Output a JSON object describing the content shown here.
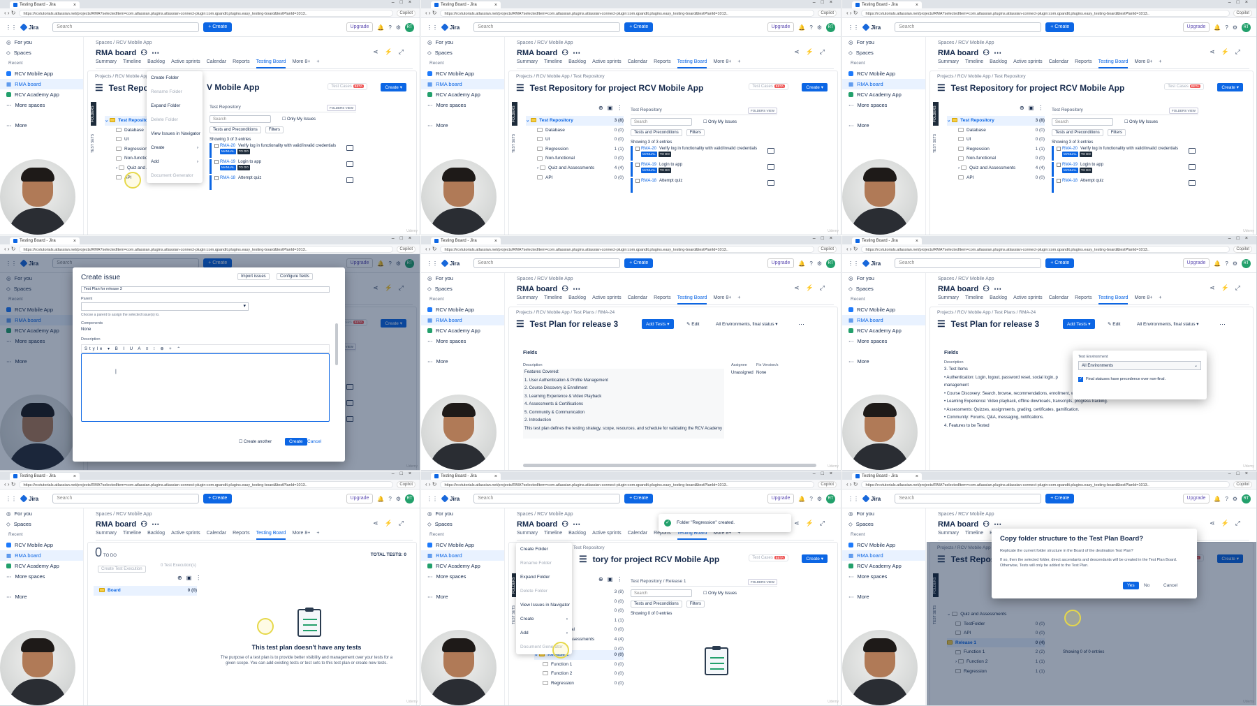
{
  "browser": {
    "tab_title": "Testing Board - Jira",
    "url": "https://rcvtutorials.atlassian.net/projects/RMA?selectedItem=com.atlassian.plugins.atlassian-connect-plugin:com.qpandit.plugins.easy_testing-board&testPlanId=1013..",
    "copilot": "Copilot"
  },
  "topnav": {
    "product": "Jira",
    "search_placeholder": "Search",
    "create": "+ Create",
    "upgrade": "Upgrade",
    "avatar": "RT"
  },
  "sidebar": {
    "for_you": "For you",
    "spaces": "Spaces",
    "recent": "Recent",
    "item1": "RCV Mobile App",
    "item2": "RMA board",
    "item3": "RCV Academy App",
    "more_spaces": "More spaces",
    "more": "More"
  },
  "board": {
    "breadcrumb": "Spaces / RCV Mobile App",
    "title": "RMA board",
    "tabs": [
      "Summary",
      "Timeline",
      "Backlog",
      "Active sprints",
      "Calendar",
      "Reports",
      "Testing Board",
      "More 8+"
    ]
  },
  "repo": {
    "breadcrumb": "Projects / RCV Mobile App / Test Repository",
    "title": "Test Repository for project RCV Mobile App",
    "title_short": "Test Repositor",
    "title_tail": "V Mobile App",
    "title_cut": "tory for project RCV Mobile App",
    "test_cases": "Test Cases",
    "beta": "BETA",
    "create": "Create",
    "folders": "FOLDERS",
    "test_sets": "TEST SETS",
    "tree": [
      {
        "label": "Test Repository",
        "count": "3 (8)"
      },
      {
        "label": "Database",
        "count": "0 (0)"
      },
      {
        "label": "UI",
        "count": "0 (0)"
      },
      {
        "label": "Regression",
        "count": "1 (1)"
      },
      {
        "label": "Non-functional",
        "count": "0 (0)"
      },
      {
        "label": "Quiz and Assessments",
        "count": "4 (4)"
      },
      {
        "label": "API",
        "count": "0 (0)"
      }
    ],
    "right_head": "Test Repository",
    "folders_view": "FOLDERS VIEW",
    "search": "Search",
    "only_my": "Only My Issues",
    "tests_precond": "Tests and Preconditions",
    "filters": "Filters",
    "showing": "Showing 3 of 3 entries",
    "items": [
      {
        "key": "RMA-20",
        "summary": "Verify log in functionality with valid/invalid credentials",
        "type": "MANUAL",
        "status": "TO DO"
      },
      {
        "key": "RMA-19",
        "summary": "Login to app",
        "type": "MANUAL",
        "status": "TO DO"
      },
      {
        "key": "RMA-18",
        "summary": "Attempt quiz",
        "type": "",
        "status": ""
      }
    ]
  },
  "context_menu": [
    "Create Folder",
    "Rename Folder",
    "Expand Folder",
    "Delete Folder",
    "View Issues in Navigator",
    "Create",
    "Add",
    "Document Generator"
  ],
  "create_issue": {
    "title": "Create issue",
    "import": "Import issues",
    "configure": "Configure fields",
    "summary_value": "Test Plan for release 3",
    "parent": "Parent",
    "parent_hint": "Choose a parent to assign the selected issue(s) to.",
    "components": "Components",
    "components_val": "None",
    "description": "Description",
    "style": "Style",
    "create_another": "Create another",
    "create": "Create",
    "cancel": "Cancel"
  },
  "plan": {
    "breadcrumb": "Projects / RCV Mobile App / Test Plans / RMA-24",
    "title": "Test Plan for release 3",
    "add_tests": "Add Tests",
    "edit": "Edit",
    "env": "All Environments, final status",
    "fields": "Fields",
    "description": "Description",
    "assignee": "Assignee",
    "assignee_val": "Unassigned",
    "fix_version": "Fix Version/s",
    "fix_val": "None",
    "features": "Features Covered:",
    "feature_list": [
      "1.  User Authentication & Profile Management",
      "2.  Course Discovery & Enrollment",
      "3.  Learning Experience & Video Playback",
      "4.  Assessments & Certifications",
      "5.  Community & Communication"
    ],
    "intro": "2. Introduction",
    "intro_text": "This test plan defines the testing strategy, scope, resources, and schedule for validating the RCV Academy",
    "test_env_label": "Test Environment",
    "test_env_val": "All Environments",
    "final_status": "Final statuses have precedence over non-final.",
    "desc2": [
      "3. Test Items",
      "•  Authentication: Login, logout, password reset, social login, p",
      "management",
      "•  Course Discovery: Search, browse, recommendations, enrollment, wishlist.",
      "•  Learning Experience: Video playback, offline downloads, transcripts, progress tracking.",
      "•  Assessments: Quizzes, assignments, grading, certificates, gamification.",
      "•  Community: Forums, Q&A, messaging, notifications.",
      "4. Features to be Tested"
    ]
  },
  "planboard": {
    "count": "0",
    "todo": "TO DO",
    "total": "TOTAL TESTS: 0",
    "create_exec": "Create Test Execution",
    "execs": "0 Test Execution(s)",
    "board": "Board",
    "board_count": "0 (0)",
    "empty_title": "This test plan doesn't have any tests",
    "empty_text": "The purpose of a test plan is to provide better visibility and management over your tests for a given scope. You can add existing tests or test sets to this test plan or create new tests."
  },
  "toast": "Folder \"Regression\" created.",
  "release_tree": [
    {
      "label": "Release 1",
      "count": "0 (0)"
    },
    {
      "label": "Function 1",
      "count": "0 (0)"
    },
    {
      "label": "Function 2",
      "count": "0 (0)"
    },
    {
      "label": "Regression",
      "count": "0 (0)"
    }
  ],
  "release_head": "Test Repository  /  Release 1",
  "showing0": "Showing 0 of 0 entries",
  "copy_dialog": {
    "title": "Copy folder structure to the Test Plan Board?",
    "line1": "Replicate the current folder structure in the Board of the destination Test Plan?",
    "line2": "If so, then the selected folder, direct ascendants and descendants will be created in the Test Plan Board. Otherwise, Tests will only be added to the Test Plan.",
    "yes": "Yes",
    "no": "No",
    "cancel": "Cancel"
  },
  "copy_tree": [
    {
      "label": "Quiz and Assessments",
      "count": ""
    },
    {
      "label": "TestFolder",
      "count": "0 (0)"
    },
    {
      "label": "API",
      "count": "0 (0)"
    },
    {
      "label": "Release 1",
      "count": "0 (4)"
    },
    {
      "label": "Function 1",
      "count": "2 (2)"
    },
    {
      "label": "Function 2",
      "count": "1 (1)"
    },
    {
      "label": "Regression",
      "count": "1 (1)"
    }
  ],
  "watermark": "Udemy"
}
